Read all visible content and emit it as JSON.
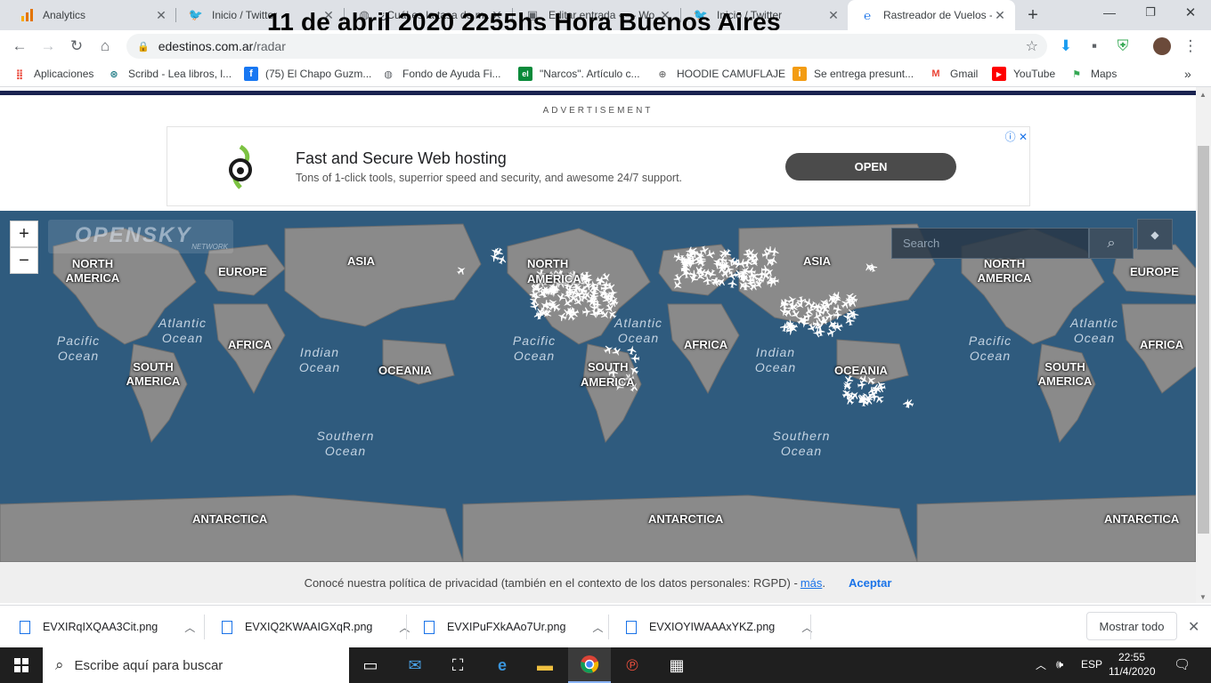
{
  "overlay_title": "11 de abril 2020 2255hs  Hora Buenos Aires",
  "tabs": [
    {
      "title": "Analytics",
      "icon": "analytics-icon"
    },
    {
      "title": "Inicio / Twitter",
      "icon": "twitter-icon"
    },
    {
      "title": "¿Cuál es la tasa de m...",
      "icon": "globe-icon"
    },
    {
      "title": "Editar entrada ‹ — Wo...",
      "icon": "wordpress-icon"
    },
    {
      "title": "Inicio / Twitter",
      "icon": "twitter-icon"
    },
    {
      "title": "Rastreador de Vuelos -",
      "icon": "edestinos-icon",
      "active": true
    }
  ],
  "address": {
    "domain": "edestinos.com.ar",
    "path": "/radar"
  },
  "bookmarks": [
    {
      "label": "Aplicaciones",
      "icon": "apps-grid-icon"
    },
    {
      "label": "Scribd - Lea libros, l...",
      "icon": "scribd-icon"
    },
    {
      "label": "(75) El Chapo Guzm...",
      "icon": "facebook-icon"
    },
    {
      "label": "Fondo de Ayuda Fi...",
      "icon": "globe-icon"
    },
    {
      "label": "\"Narcos\". Artículo c...",
      "icon": "el-icon"
    },
    {
      "label": "HOODIE CAMUFLAJE",
      "icon": "hoodie-icon"
    },
    {
      "label": "Se entrega presunt...",
      "icon": "info-icon"
    },
    {
      "label": "Gmail",
      "icon": "gmail-icon"
    },
    {
      "label": "YouTube",
      "icon": "youtube-icon"
    },
    {
      "label": "Maps",
      "icon": "maps-icon"
    }
  ],
  "ad": {
    "label": "ADVERTISEMENT",
    "title": "Fast and Secure Web hosting",
    "text": "Tons of 1-click tools, superrior speed and security, and awesome 24/7 support.",
    "button": "OPEN"
  },
  "map": {
    "logo": "OPENSKY",
    "logo_sub": "NETWORK",
    "zoom_in": "+",
    "zoom_out": "−",
    "search_placeholder": "Search",
    "labels": {
      "north_america": "NORTH AMERICA",
      "south_america": "SOUTH AMERICA",
      "europe": "EUROPE",
      "asia": "ASIA",
      "africa": "AFRICA",
      "oceania": "OCEANIA",
      "antarctica": "ANTARCTICA",
      "north": "NORTH",
      "south": "SOUTH",
      "america": "AMERICA",
      "atlantic_ocean": "Atlantic Ocean",
      "pacific_ocean": "Pacific Ocean",
      "indian_ocean": "Indian Ocean",
      "southern_ocean": "Southern Ocean"
    }
  },
  "privacy": {
    "text": "Conocé nuestra política de privacidad (también en el contexto de los datos personales: RGPD) -",
    "more": "más",
    "accept": "Aceptar"
  },
  "downloads": [
    {
      "name": "EVXIRqIXQAA3Cit.png"
    },
    {
      "name": "EVXIQ2KWAAIGXqR.png"
    },
    {
      "name": "EVXIPuFXkAAo7Ur.png"
    },
    {
      "name": "EVXIOYIWAAAxYKZ.png"
    }
  ],
  "show_all": "Mostrar todo",
  "taskbar": {
    "search_placeholder": "Escribe aquí para buscar",
    "language": "ESP",
    "time": "22:55",
    "date": "11/4/2020"
  },
  "colors": {
    "ocean": "#2f5b7e",
    "land": "#8a8a8a",
    "accent": "#1a73e8"
  }
}
